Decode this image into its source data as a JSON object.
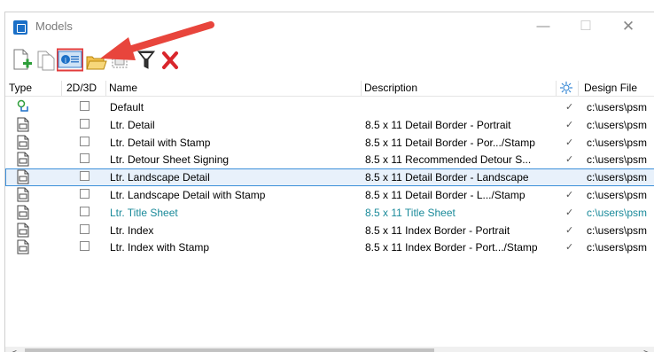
{
  "window": {
    "title": "Models",
    "minimize": "—",
    "maximize": "☐",
    "close": "✕"
  },
  "toolbar": {
    "tools": [
      {
        "name": "create-model-icon"
      },
      {
        "name": "copy-model-icon"
      },
      {
        "name": "model-properties-icon",
        "highlighted": true
      },
      {
        "name": "open-folder-icon"
      },
      {
        "name": "select-icon"
      },
      {
        "name": "filter-icon"
      },
      {
        "name": "delete-icon"
      }
    ]
  },
  "columns": {
    "type": "Type",
    "dim": "2D/3D",
    "name": "Name",
    "description": "Description",
    "design_file": "Design File"
  },
  "rows": [
    {
      "icon": "default-model-icon",
      "name": "Default",
      "description": "",
      "check": "✓",
      "design_file": "c:\\users\\psm",
      "style": ""
    },
    {
      "icon": "sheet-model-icon",
      "name": "Ltr. Detail",
      "description": "8.5 x 11 Detail Border - Portrait",
      "check": "✓",
      "design_file": "c:\\users\\psm",
      "style": ""
    },
    {
      "icon": "sheet-model-icon",
      "name": "Ltr. Detail with Stamp",
      "description": "8.5 x 11 Detail Border - Por.../Stamp",
      "check": "✓",
      "design_file": "c:\\users\\psm",
      "style": ""
    },
    {
      "icon": "sheet-model-icon",
      "name": "Ltr. Detour Sheet Signing",
      "description": "8.5 x 11 Recommended Detour S...",
      "check": "✓",
      "design_file": "c:\\users\\psm",
      "style": ""
    },
    {
      "icon": "sheet-model-icon",
      "name": "Ltr. Landscape Detail",
      "description": "8.5 x 11 Detail Border - Landscape",
      "check": "",
      "design_file": "c:\\users\\psm",
      "style": "selected"
    },
    {
      "icon": "sheet-model-icon",
      "name": "Ltr. Landscape Detail with Stamp",
      "description": "8.5 x 11 Detail Border - L.../Stamp",
      "check": "✓",
      "design_file": "c:\\users\\psm",
      "style": ""
    },
    {
      "icon": "sheet-model-icon",
      "name": "Ltr. Title Sheet",
      "description": "8.5 x 11 Title Sheet",
      "check": "✓",
      "design_file": "c:\\users\\psm",
      "style": "teal"
    },
    {
      "icon": "sheet-model-icon",
      "name": "Ltr. Index",
      "description": "8.5 x 11 Index Border - Portrait",
      "check": "✓",
      "design_file": "c:\\users\\psm",
      "style": ""
    },
    {
      "icon": "sheet-model-icon",
      "name": "Ltr. Index with Stamp",
      "description": "8.5 x 11 Index Border - Port.../Stamp",
      "check": "✓",
      "design_file": "c:\\users\\psm",
      "style": ""
    }
  ],
  "scrollbar": {
    "left": "<",
    "right": ">"
  },
  "colors": {
    "accent": "#1a6fc7",
    "highlight_box": "#e23b3b",
    "arrow": "#e8453c",
    "teal_text": "#1a8a9a",
    "selection": "#3c8fd9"
  }
}
